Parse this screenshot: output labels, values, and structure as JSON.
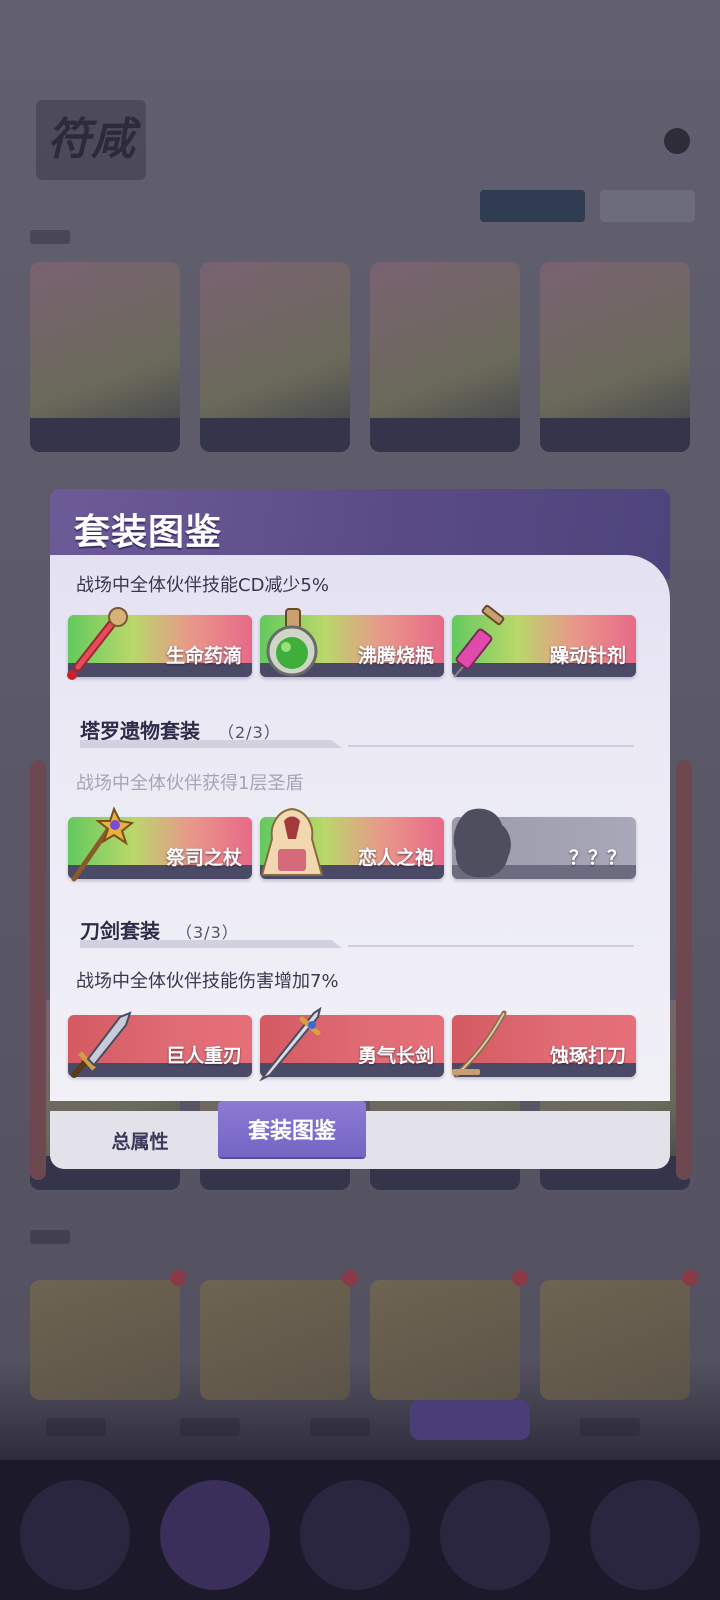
{
  "modal": {
    "title": "套装图鉴",
    "sets": [
      {
        "name": "",
        "count": "",
        "description": "战场中全体伙伴技能CD减少5%",
        "description_active": true,
        "items": [
          {
            "name": "生命药滴",
            "style": "green",
            "icon": "potion-drop-icon"
          },
          {
            "name": "沸腾烧瓶",
            "style": "green",
            "icon": "flask-icon"
          },
          {
            "name": "躁动针剂",
            "style": "green",
            "icon": "syringe-icon"
          }
        ]
      },
      {
        "name": "塔罗遗物套装",
        "count": "（2/3）",
        "description": "战场中全体伙伴获得1层圣盾",
        "description_active": false,
        "items": [
          {
            "name": "祭司之杖",
            "style": "green",
            "icon": "staff-icon"
          },
          {
            "name": "恋人之袍",
            "style": "green",
            "icon": "robe-icon"
          },
          {
            "name": "？？？",
            "style": "grey",
            "icon": "unknown-silhouette-icon"
          }
        ]
      },
      {
        "name": "刀剑套装",
        "count": "（3/3）",
        "description": "战场中全体伙伴技能伤害增加7%",
        "description_active": true,
        "items": [
          {
            "name": "巨人重刃",
            "style": "red",
            "icon": "greatblade-icon"
          },
          {
            "name": "勇气长剑",
            "style": "red",
            "icon": "longsword-icon"
          },
          {
            "name": "蚀琢打刀",
            "style": "red",
            "icon": "katana-icon"
          }
        ]
      }
    ],
    "tabs": [
      {
        "label": "总属性",
        "selected": false
      },
      {
        "label": "套装图鉴",
        "selected": true
      }
    ]
  },
  "background": {
    "logo_text": "符咸"
  },
  "colors": {
    "header": "#5a4b86",
    "selected_tab": "#7565c4",
    "body": "#eceaf5",
    "item_red": "#df6b74",
    "item_green": "#63c95e"
  }
}
